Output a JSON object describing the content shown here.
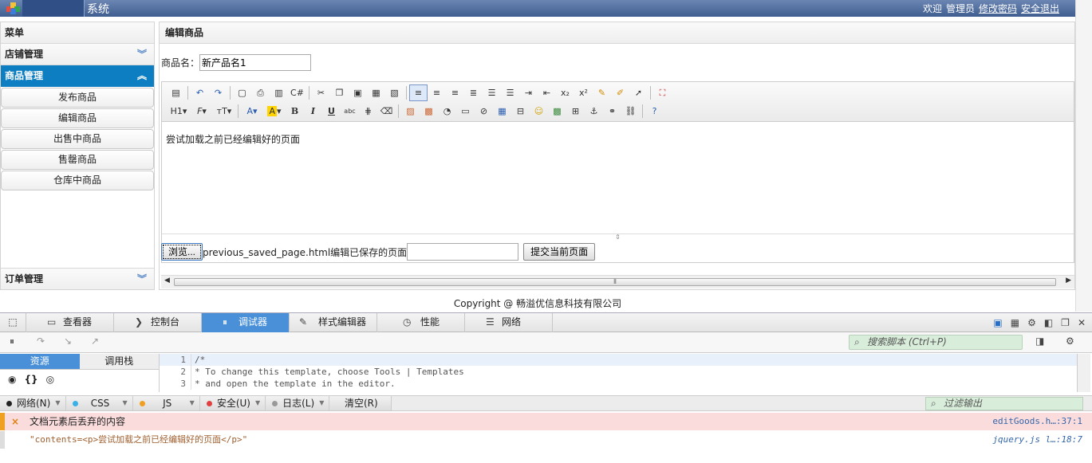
{
  "header": {
    "title": "系统",
    "welcome": "欢迎",
    "user": "管理员",
    "change_password": "修改密码",
    "logout": "安全退出"
  },
  "sidebar": {
    "title": "菜单",
    "groups": [
      {
        "label": "店铺管理"
      },
      {
        "label": "商品管理",
        "items": [
          "发布商品",
          "编辑商品",
          "出售中商品",
          "售罄商品",
          "仓库中商品"
        ]
      },
      {
        "label": "订单管理"
      }
    ]
  },
  "main": {
    "title": "编辑商品",
    "name_label": "商品名：",
    "name_value": "新产品名1",
    "editor_content": "尝试加载之前已经编辑好的页面",
    "browse_button": "浏览...",
    "file_text": "previous_saved_page.html编辑已保存的页面",
    "submit_button": "提交当前页面"
  },
  "footer": {
    "copyright": "Copyright @ 畅溢优信息科技有限公司"
  },
  "toolbar": {
    "heading": "H1",
    "bold": "B",
    "italic": "I",
    "underline": "U"
  },
  "devtools": {
    "tabs": [
      "查看器",
      "控制台",
      "调试器",
      "样式编辑器",
      "性能",
      "网络"
    ],
    "active_tab": "调试器",
    "search_scripts": "搜索脚本 (Ctrl+P)",
    "subtabs": [
      "资源",
      "调用栈"
    ],
    "code_lines": [
      {
        "num": "1",
        "text": "/*"
      },
      {
        "num": "2",
        "text": " * To change this template, choose Tools | Templates"
      },
      {
        "num": "3",
        "text": " * and open the template in the editor."
      }
    ],
    "filters": [
      {
        "label": "网络(N)",
        "color": "#222222"
      },
      {
        "label": "CSS",
        "color": "#3ab0e8"
      },
      {
        "label": "JS",
        "color": "#f0a020"
      },
      {
        "label": "安全(U)",
        "color": "#e04040"
      },
      {
        "label": "日志(L)",
        "color": "#999999"
      }
    ],
    "clear_button": "清空(R)",
    "filter_output": "过滤输出",
    "messages": [
      {
        "text": "文档元素后丢弃的内容",
        "source": "editGoods.h…:37:1"
      },
      {
        "text": "\"contents=<p>尝试加载之前已经编辑好的页面</p>\"",
        "source": "jquery.js l…:18:7"
      }
    ]
  }
}
